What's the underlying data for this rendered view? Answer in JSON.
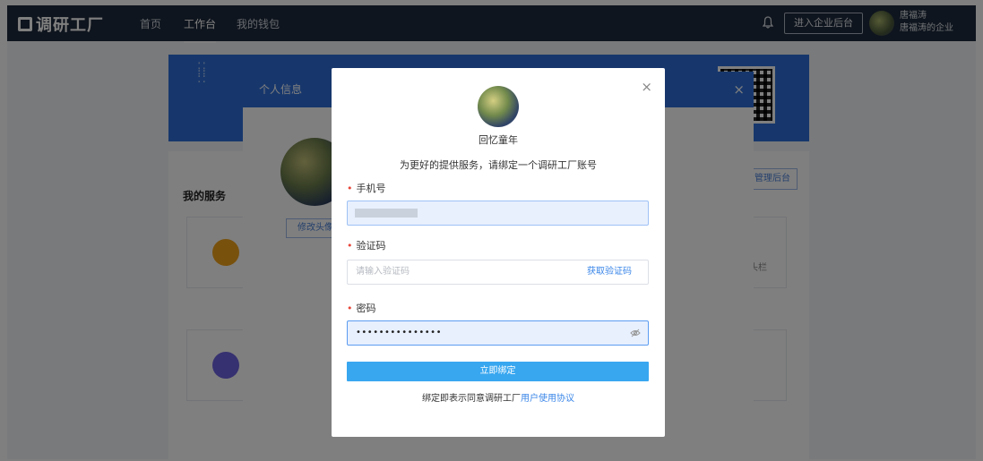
{
  "header": {
    "logo": "调研工厂",
    "nav": [
      {
        "label": "首页",
        "active": false
      },
      {
        "label": "工作台",
        "active": true
      },
      {
        "label": "我的钱包",
        "active": false
      }
    ],
    "enterprise_button": "进入企业后台",
    "user_name": "唐福涛",
    "user_company": "唐福涛的企业"
  },
  "page": {
    "services_title": "我的服务",
    "admin_button": "管理后台",
    "side_text": "头栏"
  },
  "info_dialog": {
    "title": "个人信息",
    "edit_avatar": "修改头像"
  },
  "bind_modal": {
    "nickname": "回忆童年",
    "tip": "为更好的提供服务，请绑定一个调研工厂账号",
    "phone_label": "手机号",
    "code_label": "验证码",
    "code_placeholder": "请输入验证码",
    "get_code": "获取验证码",
    "password_label": "密码",
    "password_value": "•••••••••••••••",
    "submit": "立即绑定",
    "agree_prefix": "绑定即表示同意调研工厂",
    "agree_link": "用户使用协议"
  },
  "colors": {
    "header_bg": "#1f2a3c",
    "brand_blue": "#2f6ed8",
    "submit_blue": "#38a7f0",
    "required_red": "#e8463a",
    "link_blue": "#3a86e8"
  },
  "icons": [
    "bell-icon",
    "close-icon",
    "eye-off-icon"
  ]
}
